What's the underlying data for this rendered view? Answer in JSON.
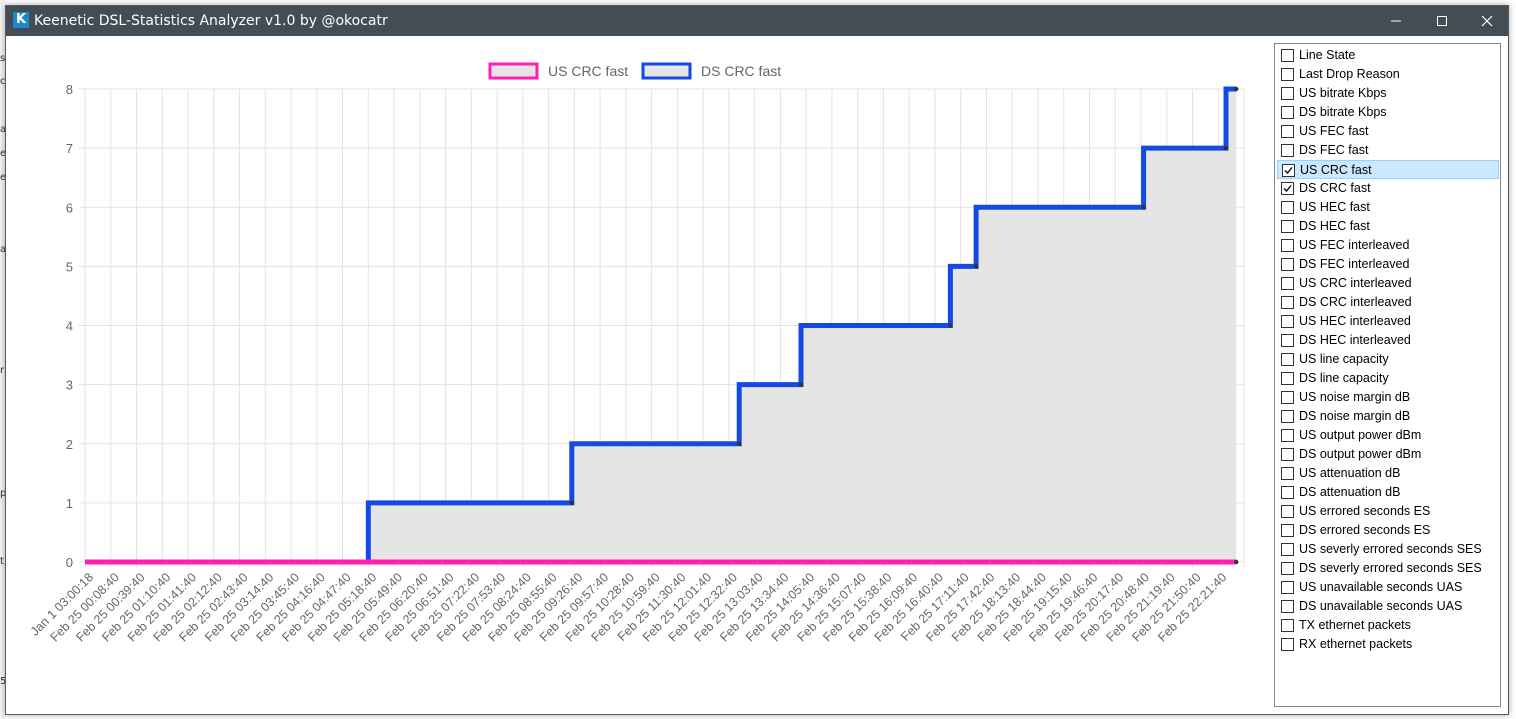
{
  "window": {
    "title": "Keenetic DSL-Statistics Analyzer v1.0 by @okocatr",
    "app_icon_letter": "K",
    "icons": [
      "app-icon",
      "minimize-icon",
      "maximize-icon",
      "close-icon"
    ]
  },
  "background_window": {
    "fragments": [
      "s",
      "c",
      "a",
      "e",
      "e",
      "a",
      "r",
      "p",
      "t",
      "5"
    ]
  },
  "chart_data": {
    "type": "line",
    "stepped": true,
    "fill": "area",
    "legend_position": "top-center",
    "grid": true,
    "ylim": [
      0,
      8
    ],
    "y_ticks": [
      "0",
      "1",
      "2",
      "3",
      "4",
      "5",
      "6",
      "7",
      "8"
    ],
    "categories": [
      "Jan  1 03:00:18",
      "Feb 25 00:08:40",
      "Feb 25 00:39:40",
      "Feb 25 01:10:40",
      "Feb 25 01:41:40",
      "Feb 25 02:12:40",
      "Feb 25 02:43:40",
      "Feb 25 03:14:40",
      "Feb 25 03:45:40",
      "Feb 25 04:16:40",
      "Feb 25 04:47:40",
      "Feb 25 05:18:40",
      "Feb 25 05:49:40",
      "Feb 25 06:20:40",
      "Feb 25 06:51:40",
      "Feb 25 07:22:40",
      "Feb 25 07:53:40",
      "Feb 25 08:24:40",
      "Feb 25 08:55:40",
      "Feb 25 09:26:40",
      "Feb 25 09:57:40",
      "Feb 25 10:28:40",
      "Feb 25 10:59:40",
      "Feb 25 11:30:40",
      "Feb 25 12:01:40",
      "Feb 25 12:32:40",
      "Feb 25 13:03:40",
      "Feb 25 13:34:40",
      "Feb 25 14:05:40",
      "Feb 25 14:36:40",
      "Feb 25 15:07:40",
      "Feb 25 15:38:40",
      "Feb 25 16:09:40",
      "Feb 25 16:40:40",
      "Feb 25 17:11:40",
      "Feb 25 17:42:40",
      "Feb 25 18:13:40",
      "Feb 25 18:44:40",
      "Feb 25 19:15:40",
      "Feb 25 19:46:40",
      "Feb 25 20:17:40",
      "Feb 25 20:48:40",
      "Feb 25 21:19:40",
      "Feb 25 21:50:40",
      "Feb 25 22:21:40"
    ],
    "series": [
      {
        "name": "US CRC fast",
        "color": "#ff1fb4",
        "fill_color": "#e5e5e5",
        "points": [
          [
            "Jan  1 03:00:18",
            0
          ],
          [
            "Feb 25 22:21:40",
            0
          ]
        ],
        "end_category_offset": 0.7
      },
      {
        "name": "DS CRC fast",
        "color": "#1549e6",
        "fill_color": "#e5e5e5",
        "steps": [
          {
            "from": 0,
            "to": 11,
            "value": 0
          },
          {
            "from": 11,
            "to": 18.9,
            "value": 1
          },
          {
            "from": 18.9,
            "to": 25.4,
            "value": 2
          },
          {
            "from": 25.4,
            "to": 27.8,
            "value": 3
          },
          {
            "from": 27.8,
            "to": 33.6,
            "value": 4
          },
          {
            "from": 33.6,
            "to": 34.6,
            "value": 5
          },
          {
            "from": 34.6,
            "to": 41.1,
            "value": 6
          },
          {
            "from": 41.1,
            "to": 44.3,
            "value": 7
          },
          {
            "from": 44.3,
            "to": 44.7,
            "value": 8
          }
        ]
      }
    ]
  },
  "series_list": {
    "items": [
      {
        "label": "Line State",
        "checked": false,
        "selected": false
      },
      {
        "label": "Last Drop Reason",
        "checked": false,
        "selected": false
      },
      {
        "label": "US bitrate Kbps",
        "checked": false,
        "selected": false
      },
      {
        "label": "DS bitrate Kbps",
        "checked": false,
        "selected": false
      },
      {
        "label": "US FEC fast",
        "checked": false,
        "selected": false
      },
      {
        "label": "DS FEC fast",
        "checked": false,
        "selected": false
      },
      {
        "label": "US CRC fast",
        "checked": true,
        "selected": true
      },
      {
        "label": "DS CRC fast",
        "checked": true,
        "selected": false
      },
      {
        "label": "US HEC fast",
        "checked": false,
        "selected": false
      },
      {
        "label": "DS HEC fast",
        "checked": false,
        "selected": false
      },
      {
        "label": "US FEC interleaved",
        "checked": false,
        "selected": false
      },
      {
        "label": "DS FEC interleaved",
        "checked": false,
        "selected": false
      },
      {
        "label": "US CRC interleaved",
        "checked": false,
        "selected": false
      },
      {
        "label": "DS CRC interleaved",
        "checked": false,
        "selected": false
      },
      {
        "label": "US HEC interleaved",
        "checked": false,
        "selected": false
      },
      {
        "label": "DS HEC interleaved",
        "checked": false,
        "selected": false
      },
      {
        "label": "US line capacity",
        "checked": false,
        "selected": false
      },
      {
        "label": "DS line capacity",
        "checked": false,
        "selected": false
      },
      {
        "label": "US noise margin dB",
        "checked": false,
        "selected": false
      },
      {
        "label": "DS noise margin dB",
        "checked": false,
        "selected": false
      },
      {
        "label": "US output power dBm",
        "checked": false,
        "selected": false
      },
      {
        "label": "DS output power dBm",
        "checked": false,
        "selected": false
      },
      {
        "label": "US attenuation dB",
        "checked": false,
        "selected": false
      },
      {
        "label": "DS attenuation dB",
        "checked": false,
        "selected": false
      },
      {
        "label": "US errored seconds ES",
        "checked": false,
        "selected": false
      },
      {
        "label": "DS errored seconds ES",
        "checked": false,
        "selected": false
      },
      {
        "label": "US severly errored seconds SES",
        "checked": false,
        "selected": false
      },
      {
        "label": "DS severly errored seconds SES",
        "checked": false,
        "selected": false
      },
      {
        "label": "US unavailable seconds UAS",
        "checked": false,
        "selected": false
      },
      {
        "label": "DS unavailable seconds UAS",
        "checked": false,
        "selected": false
      },
      {
        "label": "TX ethernet packets",
        "checked": false,
        "selected": false
      },
      {
        "label": "RX ethernet packets",
        "checked": false,
        "selected": false
      }
    ]
  }
}
